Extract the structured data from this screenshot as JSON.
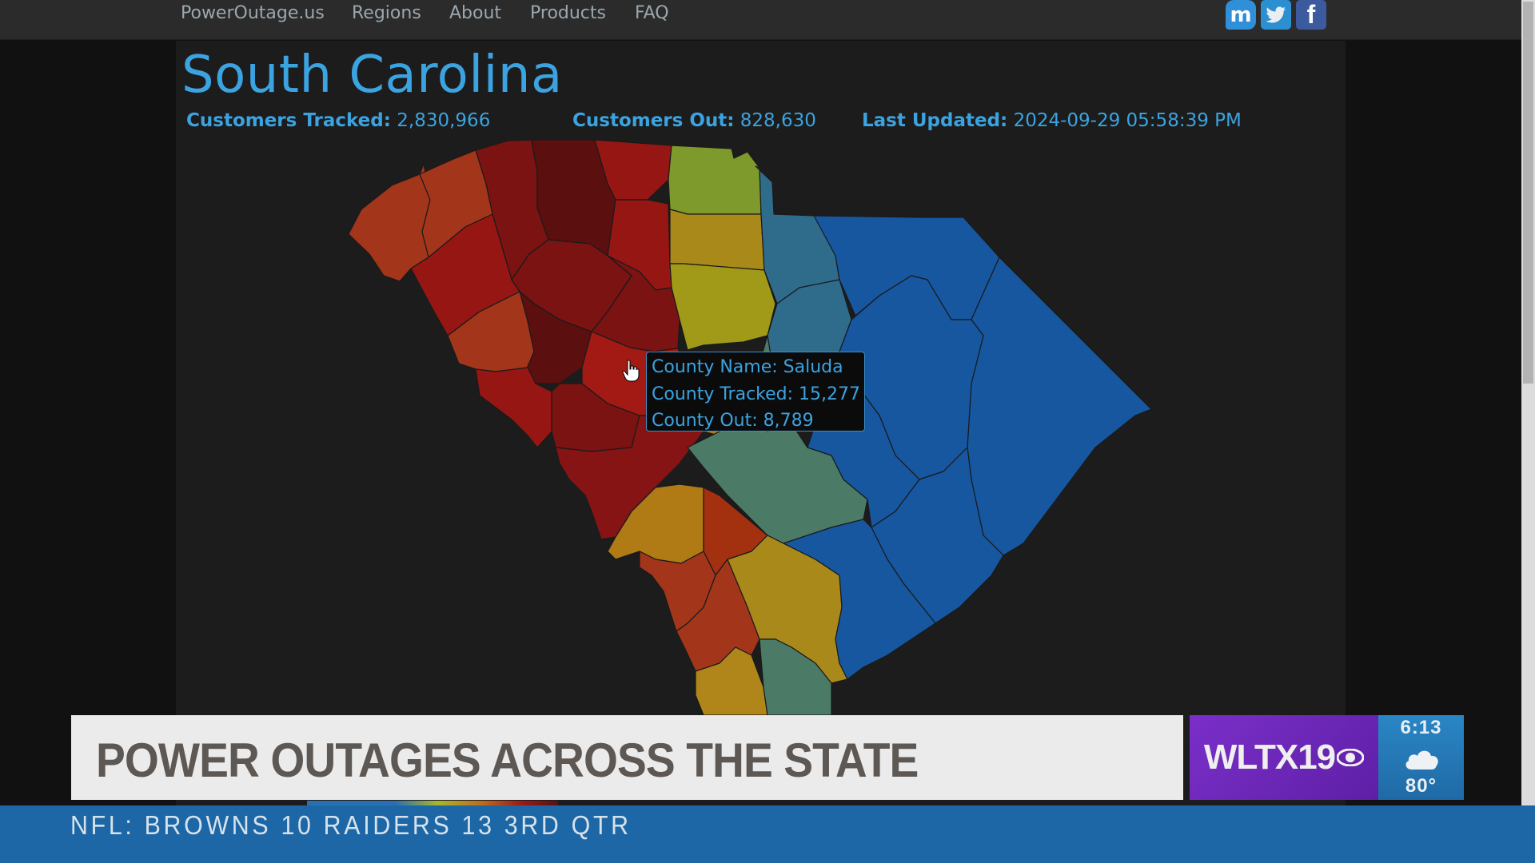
{
  "navbar": {
    "links": [
      {
        "label": "PowerOutage.us"
      },
      {
        "label": "Regions"
      },
      {
        "label": "About"
      },
      {
        "label": "Products"
      },
      {
        "label": "FAQ"
      }
    ],
    "social": [
      {
        "name": "mastodon",
        "glyph": "m",
        "color": "#2f8fd8"
      },
      {
        "name": "twitter",
        "glyph": "🐦",
        "color": "#2b8fd1"
      },
      {
        "name": "facebook",
        "glyph": "f",
        "color": "#3b5b9e"
      }
    ]
  },
  "page": {
    "title": "South Carolina",
    "stats": {
      "tracked_label": "Customers Tracked:",
      "tracked_value": "2,830,966",
      "out_label": "Customers Out:",
      "out_value": "828,630",
      "updated_label": "Last Updated:",
      "updated_value": "2024-09-29 05:58:39 PM"
    }
  },
  "map": {
    "colors": {
      "dark_red": "#5c0f0f",
      "maroon": "#7a1312",
      "red": "#961614",
      "red_orange": "#a3300f",
      "orange": "#a3361a",
      "amber": "#b07a14",
      "gold": "#a8891a",
      "yellow_olive": "#a09a18",
      "olive_green": "#7e9a2c",
      "teal_green": "#4b7a66",
      "teal_blue": "#2f6c8c",
      "blue": "#1657a0"
    },
    "tooltip": {
      "name_label": "County Name: Saluda",
      "tracked_label": "County Tracked: 15,277",
      "out_label": "County Out: 8,789"
    }
  },
  "broadcast": {
    "headline": "POWER OUTAGES ACROSS THE STATE",
    "station_logo": "WLTX19",
    "time": "6:13",
    "weather_icon": "cloud",
    "temperature": "80°",
    "ticker": "NFL: BROWNS 10   RAIDERS 13    3RD QTR"
  }
}
